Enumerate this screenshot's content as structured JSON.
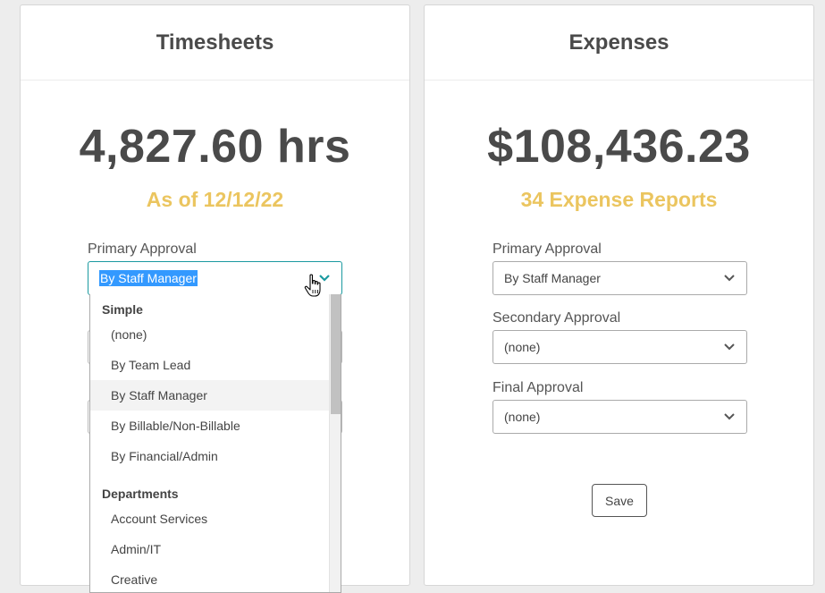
{
  "timesheets": {
    "title": "Timesheets",
    "total": "4,827.60 hrs",
    "as_of": "As of 12/12/22",
    "primary_label": "Primary Approval",
    "primary_value": "By Staff Manager"
  },
  "expenses": {
    "title": "Expenses",
    "total": "$108,436.23",
    "reports": "34 Expense Reports",
    "primary_label": "Primary Approval",
    "primary_value": "By Staff Manager",
    "secondary_label": "Secondary Approval",
    "secondary_value": "(none)",
    "final_label": "Final Approval",
    "final_value": "(none)",
    "save_label": "Save"
  },
  "dropdown": {
    "groups": [
      {
        "label": "Simple",
        "options": [
          "(none)",
          "By Team Lead",
          "By Staff Manager",
          "By Billable/Non-Billable",
          "By Financial/Admin"
        ]
      },
      {
        "label": "Departments",
        "options": [
          "Account Services",
          "Admin/IT",
          "Creative"
        ]
      }
    ],
    "highlighted": "By Staff Manager"
  },
  "colors": {
    "accent_gold": "#ebc55f",
    "focus_teal": "#1b9aa0",
    "selection_blue": "#3399ff"
  },
  "icons": {
    "chevron": "chevron-down-icon",
    "cursor": "hand-pointer-icon"
  }
}
